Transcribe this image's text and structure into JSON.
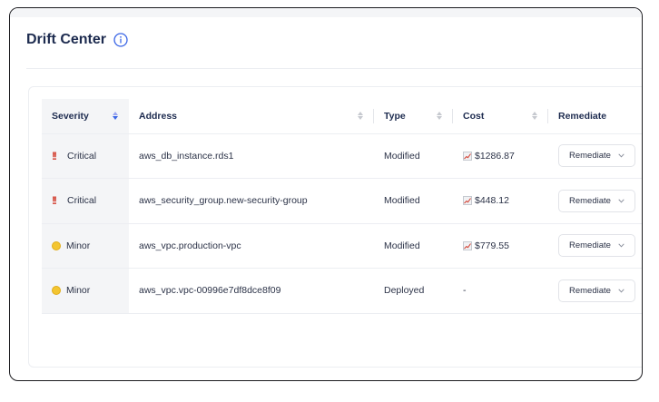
{
  "page": {
    "title": "Drift Center"
  },
  "table": {
    "headers": {
      "severity": "Severity",
      "address": "Address",
      "type": "Type",
      "cost": "Cost",
      "remediate": "Remediate"
    },
    "rows": [
      {
        "severity": "Critical",
        "severity_icon": "double-exclamation-icon",
        "address": "aws_db_instance.rds1",
        "type": "Modified",
        "cost": "$1286.87",
        "cost_icon": "trend-chart-icon",
        "action": "Remediate"
      },
      {
        "severity": "Critical",
        "severity_icon": "double-exclamation-icon",
        "address": "aws_security_group.new-security-group",
        "type": "Modified",
        "cost": "$448.12",
        "cost_icon": "trend-chart-icon",
        "action": "Remediate"
      },
      {
        "severity": "Minor",
        "severity_icon": "yellow-dot-icon",
        "address": "aws_vpc.production-vpc",
        "type": "Modified",
        "cost": "$779.55",
        "cost_icon": "trend-chart-icon",
        "action": "Remediate"
      },
      {
        "severity": "Minor",
        "severity_icon": "yellow-dot-icon",
        "address": "aws_vpc.vpc-00996e7df8dce8f09",
        "type": "Deployed",
        "cost": "-",
        "cost_icon": "",
        "action": "Remediate"
      }
    ]
  },
  "colors": {
    "title": "#1d2b4f",
    "accent": "#3b66e6",
    "critical": "#d23a2b",
    "minor": "#f3c531"
  }
}
